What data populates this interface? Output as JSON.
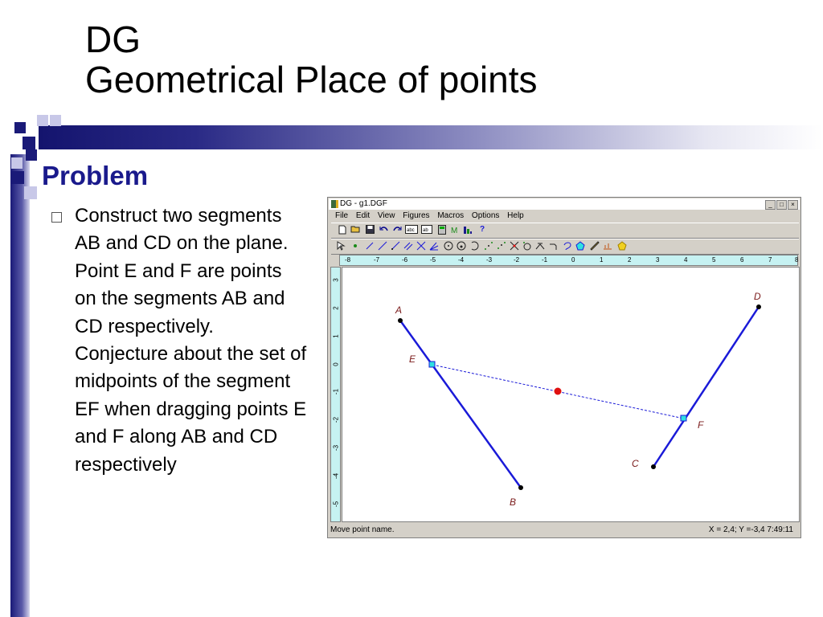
{
  "slide": {
    "title_line1": "DG",
    "title_line2": "Geometrical Place of points",
    "heading": "Problem",
    "bullet": "Construct two segments AB and CD on the plane. Point E and F are points on the segments AB and CD respectively. Conjecture about the set of midpoints of the segment EF when dragging points E and F along AB and CD respectively"
  },
  "window": {
    "title": "DG - g1.DGF",
    "controls": [
      "_",
      "□",
      "×"
    ],
    "menu": [
      "File",
      "Edit",
      "View",
      "Figures",
      "Macros",
      "Options",
      "Help"
    ],
    "toolbar1_icons": [
      "new-icon",
      "open-icon",
      "save-icon",
      "undo-icon",
      "redo-icon",
      "label-abc-icon",
      "label-ab-icon",
      "calculator-icon",
      "macro-icon",
      "info-icon",
      "help-icon"
    ],
    "toolbar1_help_label": "?",
    "toolbar2_icons": [
      "pointer-icon",
      "point-icon",
      "segment-icon",
      "line-icon",
      "ray-icon",
      "parallel-icon",
      "perpendicular-icon",
      "angle-bisector-icon",
      "circle-icon",
      "circle-3pt-icon",
      "arc-icon",
      "midpoint-icon",
      "symmetric-icon",
      "intersection-icon",
      "rotation-icon",
      "translation-icon",
      "arc2-icon",
      "locus-icon",
      "polygon-icon",
      "measure-icon",
      "ruler-icon",
      "area-icon"
    ],
    "colors": {
      "segment": "#1a1ad8",
      "midpoint": "#e01010",
      "slider_point": "#30e0e0",
      "ruler_bg": "#c6f2f2",
      "label": "#7a1a1a"
    },
    "x_ticks": [
      "-8",
      "-7",
      "-6",
      "-5",
      "-4",
      "-3",
      "-2",
      "-1",
      "0",
      "1",
      "2",
      "3",
      "4",
      "5",
      "6",
      "7",
      "8"
    ],
    "y_ticks": [
      "3",
      "2",
      "1",
      "0",
      "-1",
      "-2",
      "-3",
      "-4",
      "-5"
    ],
    "points": {
      "A": "A",
      "B": "B",
      "C": "C",
      "D": "D",
      "E": "E",
      "F": "F"
    },
    "status_left": "Move point name.",
    "status_right": "X = 2,4; Y =-3,4   7:49:11"
  }
}
